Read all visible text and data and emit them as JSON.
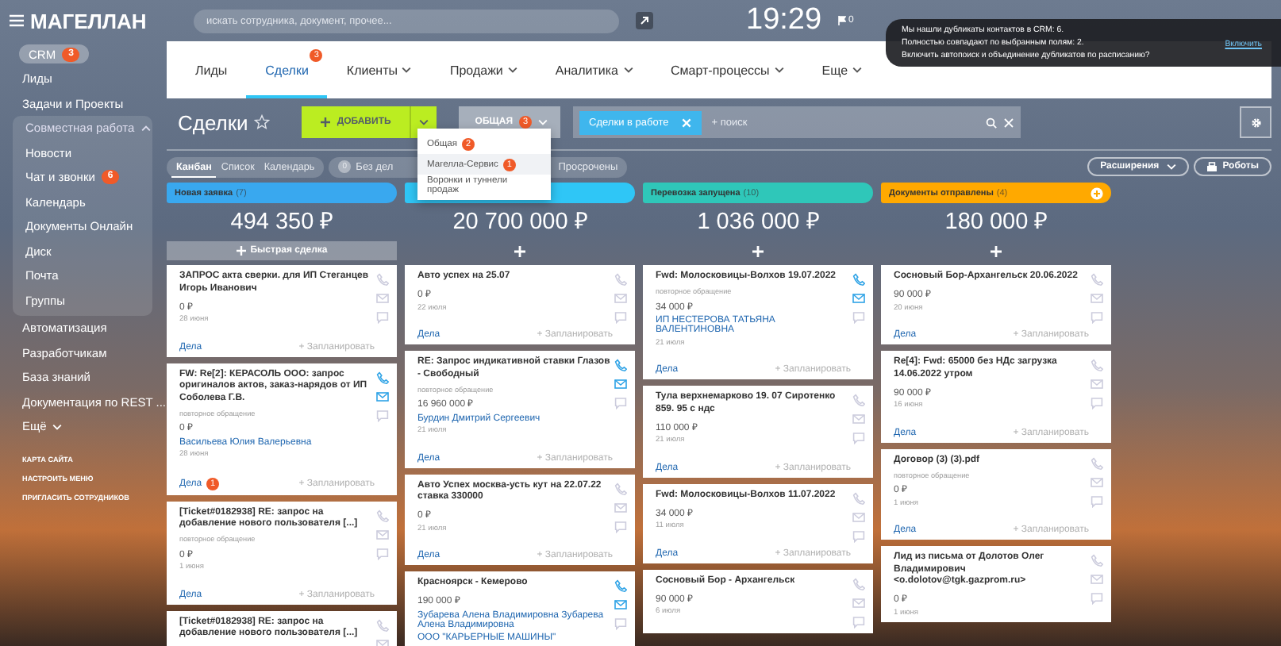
{
  "logo": "МАГЕЛЛАН",
  "sidebar": {
    "items": [
      {
        "label": "CRM",
        "badge": "3",
        "selected": true
      },
      {
        "label": "Лиды",
        "selected": false
      },
      {
        "label": "Задачи и Проекты",
        "selected": false
      },
      {
        "label": "Совместная работа",
        "expanded": true,
        "selected": false,
        "children": [
          {
            "label": "Новости",
            "selected": false
          },
          {
            "label": "Чат и звонки",
            "badge": "6",
            "selected": false
          },
          {
            "label": "Календарь",
            "selected": false
          },
          {
            "label": "Документы Онлайн",
            "selected": false
          },
          {
            "label": "Диск",
            "selected": false
          },
          {
            "label": "Почта",
            "selected": false
          },
          {
            "label": "Группы",
            "selected": false
          }
        ]
      },
      {
        "label": "Автоматизация",
        "selected": false
      },
      {
        "label": "Разработчикам",
        "selected": false
      },
      {
        "label": "База знаний",
        "selected": false
      },
      {
        "label": "Документация по REST ...",
        "selected": false
      },
      {
        "label": "Ещё",
        "more": true,
        "selected": false
      }
    ],
    "footer_links": [
      "КАРТА САЙТА",
      "НАСТРОИТЬ МЕНЮ",
      "ПРИГЛАСИТЬ СОТРУДНИКОВ"
    ]
  },
  "search": {
    "placeholder": "искать сотрудника, документ, прочее..."
  },
  "clock": "19:29",
  "flag_count": "0",
  "notification": {
    "lines": [
      "Мы нашли дубликаты контактов в CRM: 6.",
      "Полностью совпадают по выбранным полям: 2.",
      "Включить автопоиск и объединение дубликатов по расписанию?"
    ],
    "link": "Включить"
  },
  "tabs": [
    {
      "label": "Лиды",
      "selected": false
    },
    {
      "label": "Сделки",
      "badge": "3",
      "selected": true
    },
    {
      "label": "Клиенты",
      "dropdown": true,
      "selected": false
    },
    {
      "label": "Продажи",
      "dropdown": true,
      "selected": false
    },
    {
      "label": "Аналитика",
      "dropdown": true,
      "selected": false
    },
    {
      "label": "Смарт-процессы",
      "dropdown": true,
      "selected": false
    },
    {
      "label": "Еще",
      "dropdown": true,
      "selected": false
    }
  ],
  "page_title": "Сделки",
  "add_button": "ДОБАВИТЬ",
  "pipeline_button": {
    "label": "ОБЩАЯ",
    "badge": "3"
  },
  "pipeline_menu": [
    {
      "label": "Общая",
      "badge": "2",
      "selected": false
    },
    {
      "label": "Магелла-Сервис",
      "badge": "1",
      "selected": true
    },
    {
      "label": "Воронки и туннели продаж",
      "selected": false
    }
  ],
  "filter": {
    "tag": "Сделки в работе",
    "placeholder": "+ поиск"
  },
  "views": [
    {
      "label": "Канбан",
      "selected": true
    },
    {
      "label": "Список",
      "selected": false
    },
    {
      "label": "Календарь",
      "selected": false
    }
  ],
  "counters": [
    {
      "count": "0",
      "label": "Без дел"
    },
    {
      "label": "Просрочены"
    }
  ],
  "extensions_button": "Расширения",
  "robots_button": "Роботы",
  "columns": [
    {
      "title": "Новая заявка",
      "count": "(7)",
      "color": "#39a8ef",
      "plus_button": false,
      "sum": "494 350 ₽",
      "quick_add": "Быстрая сделка",
      "cards": [
        {
          "title": "ЗАПРОС акта сверки. для ИП Стеганцев Игорь Иванович",
          "amount": "0 ₽",
          "date": "28 июня",
          "phone": false,
          "mail": false,
          "tasks": "Дела",
          "plan": "+ Запланировать"
        },
        {
          "title": "FW: Re[2]: КЕРАСОЛЬ ООО: запрос оригиналов актов, заказ-нарядов от ИП Соболева Г.В.",
          "note": "повторное обращение",
          "amount": "0 ₽",
          "contact": "Васильева Юлия Валерьевна",
          "date": "28 июня",
          "phone": true,
          "mail": true,
          "tasks": "Дела",
          "tasks_badge": "1",
          "plan": "+ Запланировать"
        },
        {
          "title": "[Ticket#0182938] RE: запрос на добавление нового пользователя [...]",
          "note": "повторное обращение",
          "amount": "0 ₽",
          "date": "1 июня",
          "phone": false,
          "mail": false,
          "tasks": "Дела",
          "plan": "+ Запланировать"
        },
        {
          "title": "[Ticket#0182938] RE: запрос на добавление нового пользователя [...]",
          "phone": false,
          "mail": false
        }
      ]
    },
    {
      "color": "#2fc6f6",
      "plus_button": false,
      "sum": "20 700 000 ₽",
      "cards": [
        {
          "title": "Авто успех на 25.07",
          "amount": "0 ₽",
          "date": "22 июля",
          "phone": false,
          "mail": false,
          "tasks": "Дела",
          "plan": "+ Запланировать"
        },
        {
          "title": "RE: Запрос индикативной ставки Глазов - Свободный",
          "note": "повторное обращение",
          "amount": "16 960 000 ₽",
          "contact": "Бурдин Дмитрий Сергеевич",
          "date": "21 июля",
          "phone": true,
          "mail": true,
          "tasks": "Дела",
          "plan": "+ Запланировать"
        },
        {
          "title": "Авто Успех москва-усть кут на 22.07.22 ставка 330000",
          "amount": "0 ₽",
          "date": "21 июля",
          "phone": false,
          "mail": false,
          "tasks": "Дела",
          "plan": "+ Запланировать"
        },
        {
          "title": "Красноярск - Кемерово",
          "amount": "190 000 ₽",
          "contact": "Зубарева Алена Владимировна Зубарева Алена Владимировна",
          "company": "ООО \"КАРЬЕРНЫЕ МАШИНЫ\"",
          "phone": true,
          "mail": true
        }
      ]
    },
    {
      "title": "Перевозка запущена",
      "count": "(10)",
      "color": "#2fc7b9",
      "plus_button": false,
      "sum": "1 036 000 ₽",
      "cards": [
        {
          "title": "Fwd: Молосковицы-Волхов 19.07.2022",
          "note": "повторное обращение",
          "amount": "34 000 ₽",
          "contact": "ИП НЕСТЕРОВА ТАТЬЯНА ВАЛЕНТИНОВНА",
          "date": "21 июля",
          "phone": true,
          "mail": true,
          "tasks": "Дела",
          "plan": "+ Запланировать"
        },
        {
          "title": "Тула верхнемарково 19. 07 Сиротенко 859. 95 с ндс",
          "amount": "110 000 ₽",
          "date": "21 июля",
          "phone": false,
          "mail": false,
          "tasks": "Дела",
          "plan": "+ Запланировать"
        },
        {
          "title": "Fwd: Молосковицы-Волхов 11.07.2022",
          "amount": "34 000 ₽",
          "date": "11 июля",
          "phone": false,
          "mail": false,
          "tasks": "Дела",
          "plan": "+ Запланировать"
        },
        {
          "title": "Сосновый Бор - Архангельск",
          "amount": "90 000 ₽",
          "date": "6 июля",
          "phone": false,
          "mail": false
        }
      ]
    },
    {
      "title": "Документы отправлены",
      "count": "(4)",
      "color": "#ffa900",
      "plus_button": true,
      "sum": "180 000 ₽",
      "cards": [
        {
          "title": "Сосновый Бор-Архангельск 20.06.2022",
          "amount": "90 000 ₽",
          "date": "20 июня",
          "phone": false,
          "mail": false,
          "tasks": "Дела",
          "plan": "+ Запланировать"
        },
        {
          "title": "Re[4]: Fwd: 65000 без НДс загрузка 14.06.2022 утром",
          "amount": "90 000 ₽",
          "date": "16 июня",
          "phone": false,
          "mail": false,
          "tasks": "Дела",
          "plan": "+ Запланировать"
        },
        {
          "title": "Договор (3) (3).pdf",
          "note": "повторное обращение",
          "amount": "0 ₽",
          "date": "1 июня",
          "phone": false,
          "mail": false,
          "tasks": "Дела",
          "plan": "+ Запланировать"
        },
        {
          "title": "Лид из письма от Долотов Олег Владимирович <o.dolotov@tgk.gazprom.ru>",
          "amount": "0 ₽",
          "date": "1 июня",
          "phone": false,
          "mail": false
        }
      ]
    }
  ]
}
